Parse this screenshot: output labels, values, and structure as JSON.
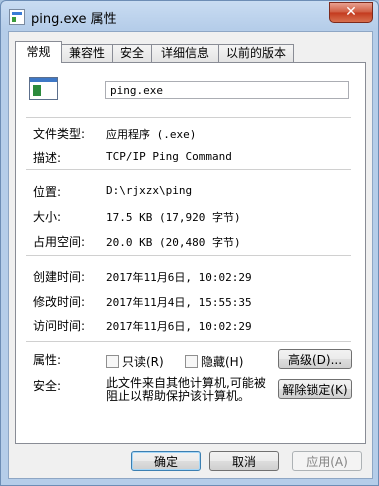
{
  "window": {
    "title": "ping.exe 属性",
    "close_label": "✕"
  },
  "tabs": [
    {
      "label": "常规",
      "active": true
    },
    {
      "label": "兼容性",
      "active": false
    },
    {
      "label": "安全",
      "active": false
    },
    {
      "label": "详细信息",
      "active": false
    },
    {
      "label": "以前的版本",
      "active": false
    }
  ],
  "general": {
    "file_name": "ping.exe",
    "file_type_label": "文件类型:",
    "file_type_value": "应用程序 (.exe)",
    "description_label": "描述:",
    "description_value": "TCP/IP Ping Command",
    "location_label": "位置:",
    "location_value": "D:\\rjxzx\\ping",
    "size_label": "大小:",
    "size_value": "17.5 KB (17,920 字节)",
    "size_on_disk_label": "占用空间:",
    "size_on_disk_value": "20.0 KB (20,480 字节)",
    "created_label": "创建时间:",
    "created_value": "2017年11月6日, 10:02:29",
    "modified_label": "修改时间:",
    "modified_value": "2017年11月4日, 15:55:35",
    "accessed_label": "访问时间:",
    "accessed_value": "2017年11月6日, 10:02:29",
    "attributes_label": "属性:",
    "readonly_label": "只读(R)",
    "hidden_label": "隐藏(H)",
    "advanced_label": "高级(D)...",
    "security_label": "安全:",
    "security_text": "此文件来自其他计算机,可能被阻止以帮助保护该计算机。",
    "unblock_label": "解除锁定(K)"
  },
  "footer": {
    "ok_label": "确定",
    "cancel_label": "取消",
    "apply_label": "应用(A)"
  },
  "colors": {
    "window_frame": "#b5cde9",
    "close_button": "#c3391d",
    "default_button_border": "#3c7fb1"
  },
  "icons": {
    "title_icon": "app-icon",
    "file_icon": "exe-file-icon",
    "close_icon": "close-icon"
  }
}
